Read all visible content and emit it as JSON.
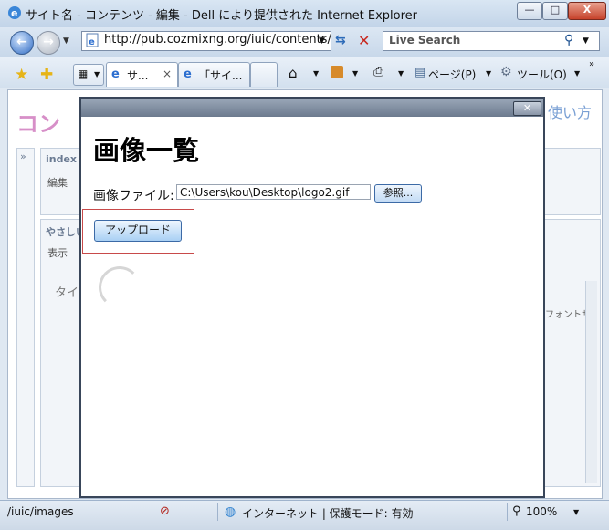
{
  "window": {
    "title": "サイト名 - コンテンツ - 編集 - Dell により提供された Internet Explorer",
    "minimize": "—",
    "maximize": "□",
    "close": "X"
  },
  "address_bar": {
    "url": "http://pub.cozmixng.org/iuic/contents/",
    "search_placeholder": "Live Search"
  },
  "tabs": [
    {
      "label": "サ...",
      "close": "×"
    },
    {
      "label": "「サイ..."
    }
  ],
  "toolbar": {
    "page_menu": "ページ(P)",
    "tools_menu": "ツール(O)"
  },
  "background_page": {
    "title_partial": "コン",
    "help_link": "使い方",
    "panel1_title": "index",
    "panel1_item": "編集",
    "panel2_title": "やさしい",
    "panel2_item": "表示",
    "form_label": "タイ",
    "font_label": "フォントサ"
  },
  "modal": {
    "title": "画像一覧",
    "file_label": "画像ファイル:",
    "file_value": "C:\\Users\\kou\\Desktop\\logo2.gif",
    "browse_label": "参照...",
    "upload_label": "アップロード",
    "close_glyph": "✕"
  },
  "status_bar": {
    "path": "/iuic/images",
    "zone": "インターネット | 保護モード: 有効",
    "zoom": "100%"
  },
  "colors": {
    "highlight_border": "#c84a4a",
    "modal_border": "#39465a",
    "background_title": "#d78fc8"
  }
}
